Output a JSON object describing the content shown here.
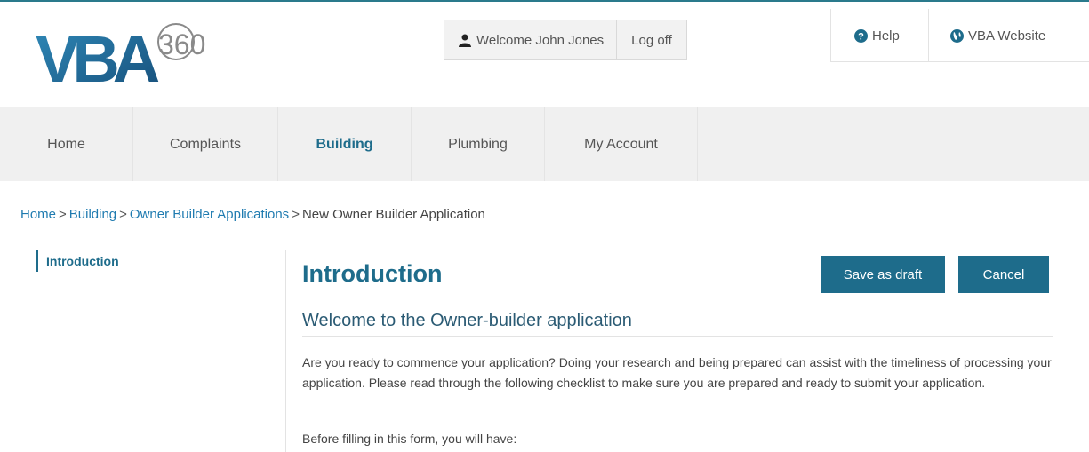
{
  "header": {
    "logo_text": "VBA",
    "logo_badge": "360",
    "welcome_text": "Welcome John Jones",
    "logoff_label": "Log off",
    "help_label": "Help",
    "vba_website_label": "VBA Website"
  },
  "nav": {
    "items": [
      {
        "label": "Home"
      },
      {
        "label": "Complaints"
      },
      {
        "label": "Building"
      },
      {
        "label": "Plumbing"
      },
      {
        "label": "My Account"
      }
    ],
    "active": "Building"
  },
  "breadcrumb": {
    "items": [
      {
        "label": "Home"
      },
      {
        "label": "Building"
      },
      {
        "label": "Owner Builder Applications"
      }
    ],
    "separator": ">",
    "current": "New Owner Builder Application"
  },
  "sidebar": {
    "items": [
      {
        "label": "Introduction"
      }
    ]
  },
  "main": {
    "title": "Introduction",
    "save_draft_label": "Save as draft",
    "cancel_label": "Cancel",
    "subtitle": "Welcome to the Owner-builder application",
    "paragraph": "Are you ready to commence your application? Doing your research and being prepared can assist with the timeliness of processing your application. Please read through the following checklist to make sure you are prepared and ready to submit your application.",
    "paragraph2": "Before filling in this form, you will have:"
  },
  "colors": {
    "brand": "#1e6c8b",
    "link": "#1f7bb0",
    "nav_bg": "#f0f0f0"
  },
  "icons": {
    "user": "user-icon",
    "help": "question-circle-icon",
    "website": "globe-icon"
  }
}
